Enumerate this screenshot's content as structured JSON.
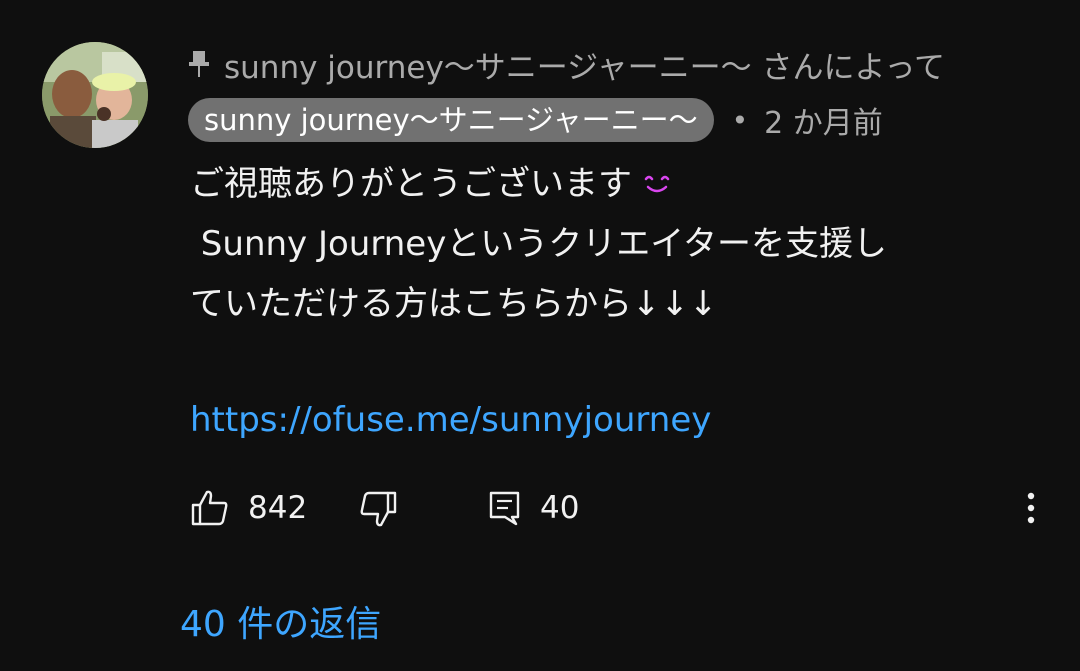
{
  "comment": {
    "pinned_text": "sunny journey〜サニージャーニー〜 さんによって",
    "author_name": "sunny journey〜サニージャーニー〜",
    "separator": "•",
    "timestamp": "2 か月前",
    "body_lines": [
      "ご視聴ありがとうございます",
      " Sunny Journeyというクリエイターを支援し",
      "ていただける方はこちらから↓↓↓"
    ],
    "link_text": "https://ofuse.me/sunnyjourney",
    "like_count": "842",
    "reply_count": "40",
    "view_replies_label": "40 件の返信",
    "emoji_color": "#d946ef",
    "link_color": "#3ea6ff"
  }
}
